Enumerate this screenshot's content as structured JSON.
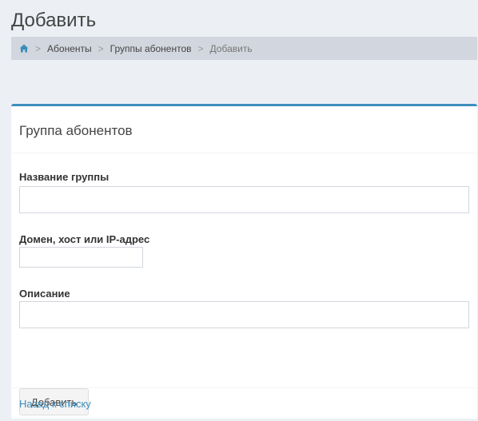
{
  "page": {
    "title": "Добавить"
  },
  "breadcrumb": {
    "home_icon": "home-icon",
    "items": [
      "Абоненты",
      "Группы абонентов"
    ],
    "current": "Добавить",
    "separator": ">"
  },
  "box": {
    "title": "Группа абонентов"
  },
  "form": {
    "name_label": "Название группы",
    "name_value": "",
    "host_label": "Домен, хост или IP-адрес",
    "host_value": "",
    "description_label": "Описание",
    "description_value": "",
    "submit_label": "Добавить"
  },
  "footer": {
    "back_link": "Назад к списку"
  },
  "colors": {
    "accent": "#3c8dbc",
    "background": "#ecf0f5",
    "breadcrumb_bg": "#d2d6de"
  }
}
